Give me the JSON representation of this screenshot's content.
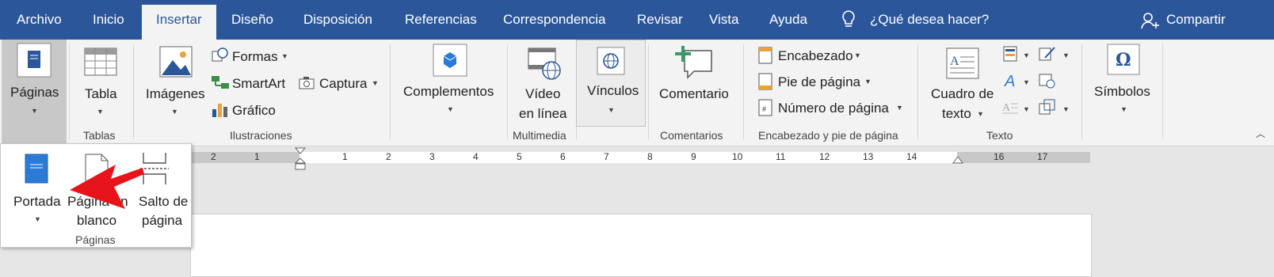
{
  "tabs": {
    "archivo": "Archivo",
    "inicio": "Inicio",
    "insertar": "Insertar",
    "diseno": "Diseño",
    "disposicion": "Disposición",
    "referencias": "Referencias",
    "correspondencia": "Correspondencia",
    "revisar": "Revisar",
    "vista": "Vista",
    "ayuda": "Ayuda"
  },
  "tell_me": "¿Qué desea hacer?",
  "share": "Compartir",
  "ribbon": {
    "paginas": "Páginas",
    "tabla": "Tabla",
    "tablas_group": "Tablas",
    "imagenes": "Imágenes",
    "formas": "Formas",
    "smartart": "SmartArt",
    "grafico": "Gráfico",
    "captura": "Captura",
    "ilustraciones_group": "Ilustraciones",
    "complementos": "Complementos",
    "video_linea_1": "Vídeo",
    "video_linea_2": "en línea",
    "multimedia_group": "Multimedia",
    "vinculos": "Vínculos",
    "comentario": "Comentario",
    "comentarios_group": "Comentarios",
    "encabezado": "Encabezado",
    "pie_pagina": "Pie de página",
    "numero_pagina": "Número de página",
    "encabezado_group": "Encabezado y pie de página",
    "cuadro_texto_1": "Cuadro de",
    "cuadro_texto_2": "texto",
    "texto_group": "Texto",
    "simbolos": "Símbolos"
  },
  "ruler": {
    "numbers": [
      "2",
      "1",
      "1",
      "2",
      "3",
      "4",
      "5",
      "6",
      "7",
      "8",
      "9",
      "10",
      "11",
      "12",
      "13",
      "14",
      "16",
      "17"
    ]
  },
  "popup": {
    "portada": "Portada",
    "pagina_blanco_1": "Página en",
    "pagina_blanco_2": "blanco",
    "salto_1": "Salto de",
    "salto_2": "página",
    "group": "Páginas"
  },
  "colors": {
    "tabbar": "#2b579a",
    "ribbon": "#f3f3f3",
    "annotation_arrow": "#e8141b"
  }
}
